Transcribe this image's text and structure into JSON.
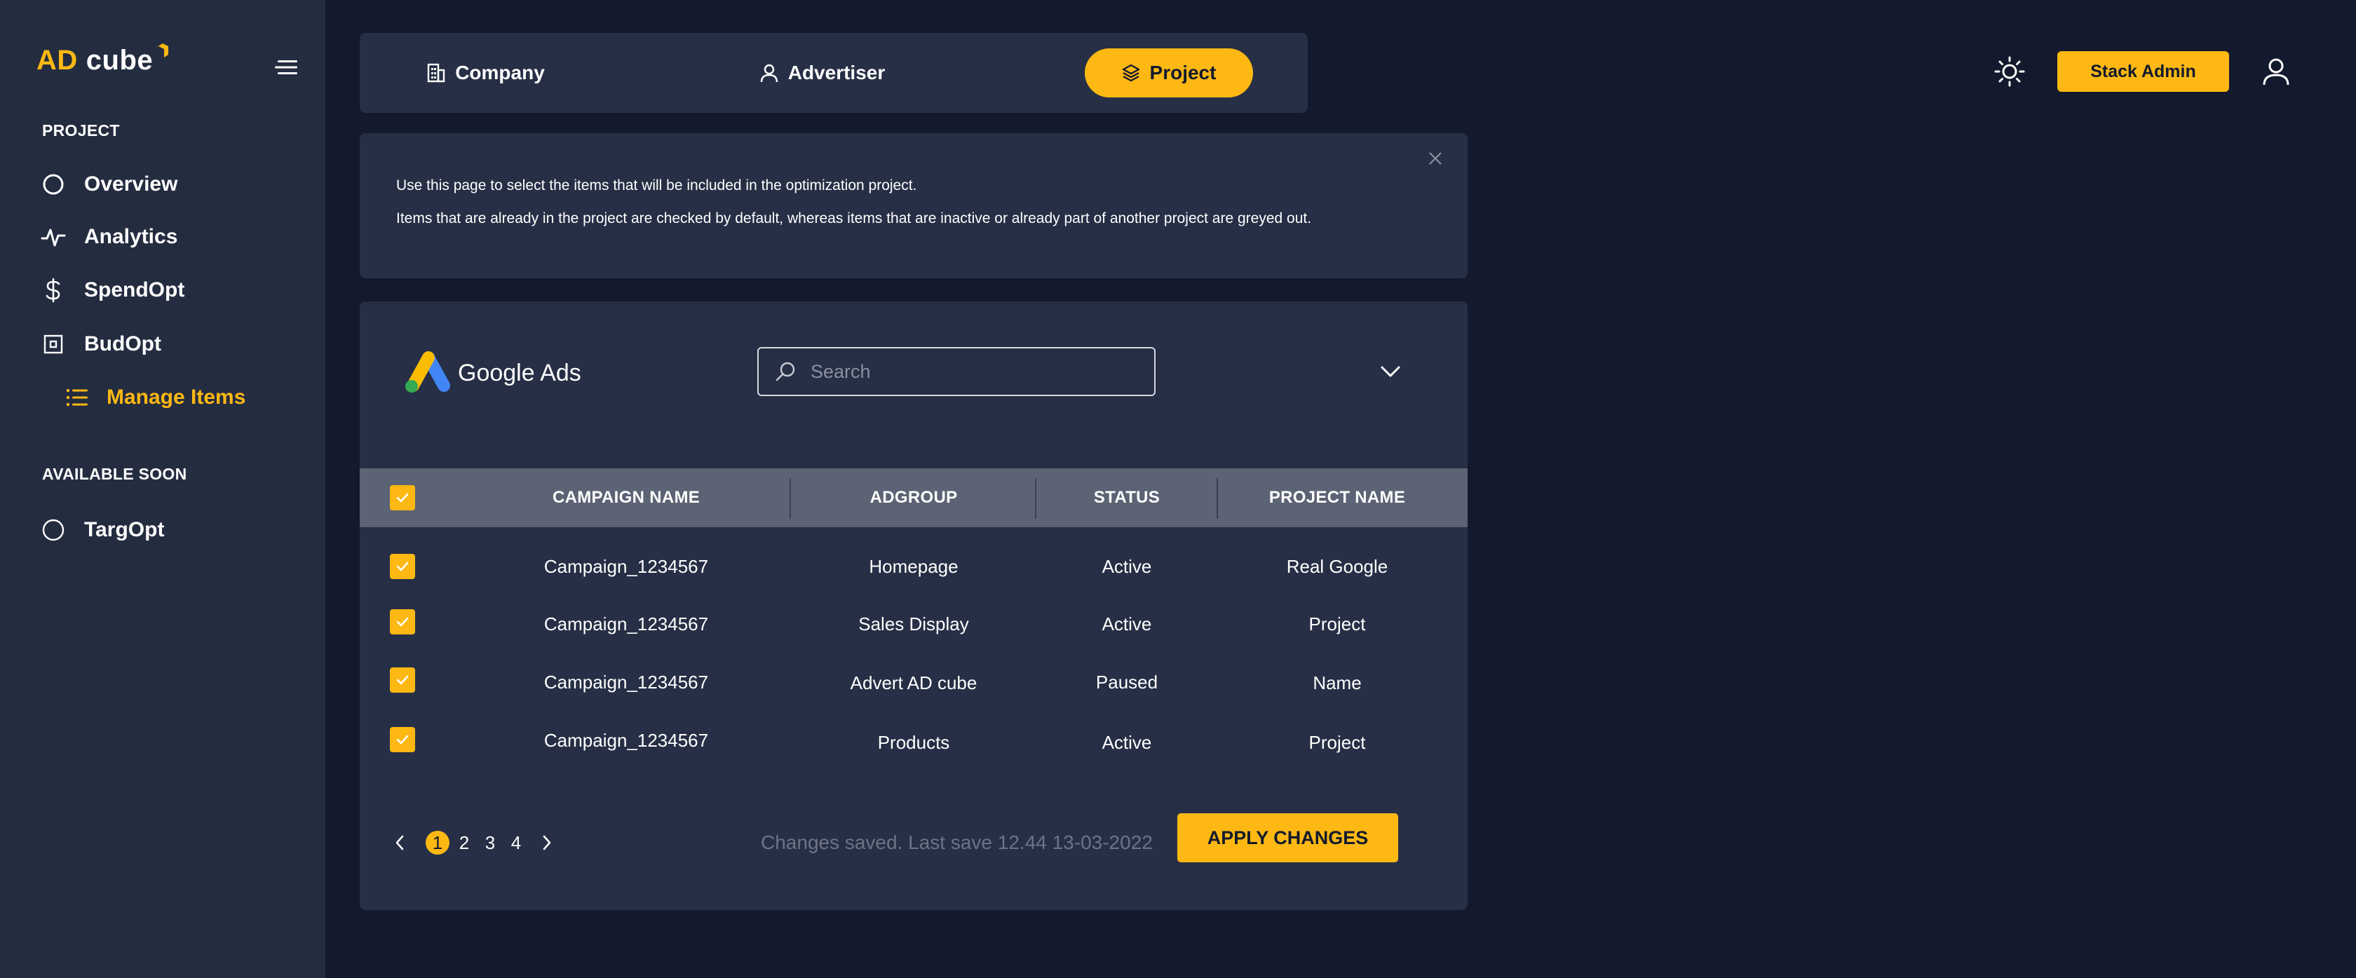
{
  "brand": {
    "logo_ad": "AD",
    "logo_cube": "cube",
    "accent": "#fdb813"
  },
  "sidebar": {
    "section_project": "PROJECT",
    "items": [
      {
        "label": "Overview",
        "icon": "circle-icon"
      },
      {
        "label": "Analytics",
        "icon": "pulse-icon"
      },
      {
        "label": "SpendOpt",
        "icon": "dollar-icon"
      },
      {
        "label": "BudOpt",
        "icon": "square-box-icon"
      }
    ],
    "sub_item": {
      "label": "Manage Items",
      "icon": "list-icon"
    },
    "section_soon": "AVAILABLE SOON",
    "soon_items": [
      {
        "label": "TargOpt",
        "icon": "circle-icon"
      }
    ]
  },
  "tabs": [
    {
      "label": "Company",
      "icon": "building-icon",
      "active": false
    },
    {
      "label": "Advertiser",
      "icon": "user-icon",
      "active": false
    },
    {
      "label": "Project",
      "icon": "layers-icon",
      "active": true
    }
  ],
  "header": {
    "admin_label": "Stack Admin"
  },
  "info": {
    "line1": "Use this page to select the items that will be included in the optimization project.",
    "line2": "Items that are already in the project are checked by default, whereas items that are inactive or already part of another project are greyed out."
  },
  "platform": {
    "name": "Google Ads"
  },
  "search": {
    "placeholder": "Search",
    "value": ""
  },
  "table": {
    "columns": [
      "CAMPAIGN NAME",
      "ADGROUP",
      "STATUS",
      "PROJECT NAME"
    ],
    "rows": [
      {
        "checked": true,
        "campaign": "Campaign_1234567",
        "adgroup": "Homepage",
        "status": "Active",
        "project": "Real Google"
      },
      {
        "checked": true,
        "campaign": "Campaign_1234567",
        "adgroup": "Sales Display",
        "status": "Active",
        "project": "Project"
      },
      {
        "checked": true,
        "campaign": "Campaign_1234567",
        "adgroup": "Advert AD cube",
        "status": "Paused",
        "project": "Name"
      },
      {
        "checked": true,
        "campaign": "Campaign_1234567",
        "adgroup": "Products",
        "status": "Active",
        "project": "Project"
      }
    ]
  },
  "pagination": {
    "pages": [
      "1",
      "2",
      "3",
      "4"
    ],
    "current": "1"
  },
  "footer": {
    "save_status": "Changes saved. Last save 12.44 13-03-2022",
    "apply_label": "APPLY CHANGES"
  }
}
